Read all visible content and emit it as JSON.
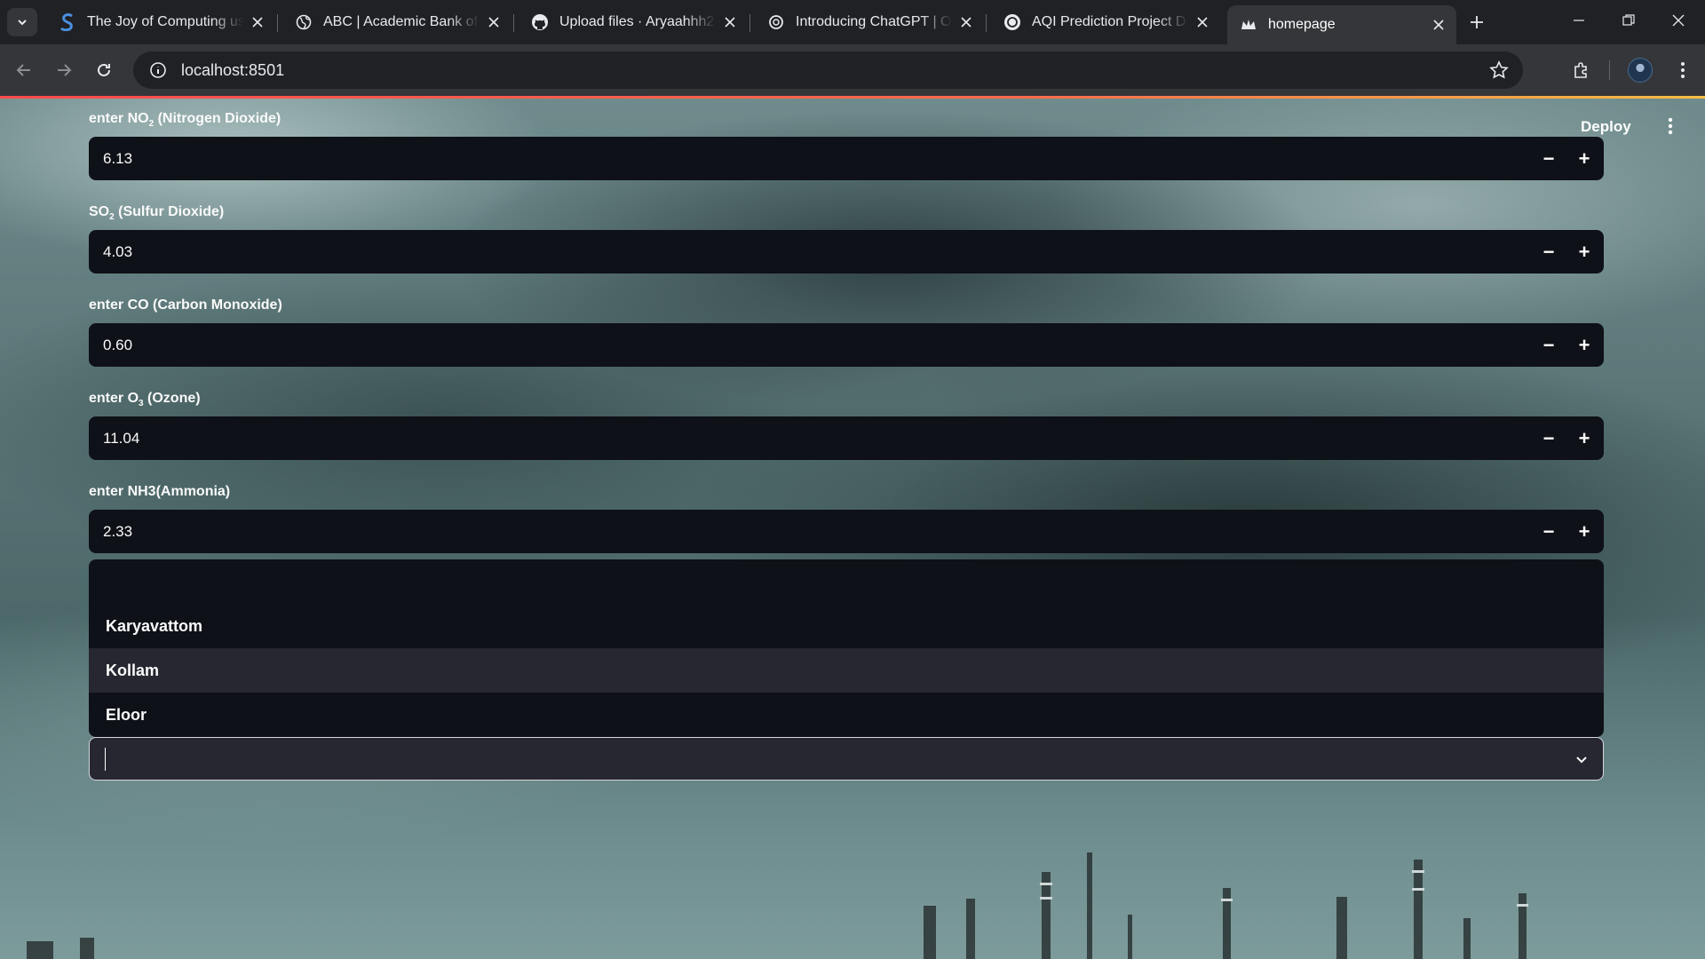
{
  "browser": {
    "tabs": [
      {
        "title": "The Joy of Computing usin",
        "icon": "swayam-icon"
      },
      {
        "title": "ABC | Academic Bank of Cr",
        "icon": "globe-icon"
      },
      {
        "title": "Upload files · Aryaahhh27/",
        "icon": "github-icon"
      },
      {
        "title": "Introducing ChatGPT | Ope",
        "icon": "openai-icon"
      },
      {
        "title": "AQI Prediction Project Des",
        "icon": "openai-icon"
      },
      {
        "title": "homepage",
        "icon": "streamlit-crown-icon",
        "active": true
      }
    ],
    "url": "localhost:8501"
  },
  "app": {
    "deploy_label": "Deploy",
    "fields": [
      {
        "label_prefix": "enter NO",
        "label_sub": "2",
        "label_suffix": " (Nitrogen Dioxide)",
        "value": "6.13"
      },
      {
        "label_prefix": "SO",
        "label_sub": "2",
        "label_suffix": " (Sulfur Dioxide)",
        "value": "4.03"
      },
      {
        "label_prefix": "enter CO (Carbon Monoxide)",
        "label_sub": "",
        "label_suffix": "",
        "value": "0.60"
      },
      {
        "label_prefix": "enter O",
        "label_sub": "3",
        "label_suffix": " (Ozone)",
        "value": "11.04"
      },
      {
        "label_prefix": "enter NH3(Ammonia)",
        "label_sub": "",
        "label_suffix": "",
        "value": "2.33"
      }
    ],
    "stepper": {
      "minus": "−",
      "plus": "+"
    },
    "location_options": [
      "Karyavattom",
      "Kollam",
      "Eloor"
    ],
    "highlighted_option": "Kollam",
    "select_value": ""
  },
  "colors": {
    "input_bg": "#0e1117",
    "select_bg": "#262730",
    "highlight_bg": "#262730",
    "accent_gradient_start": "#ff4b4b",
    "accent_gradient_end": "#ffbd45"
  }
}
